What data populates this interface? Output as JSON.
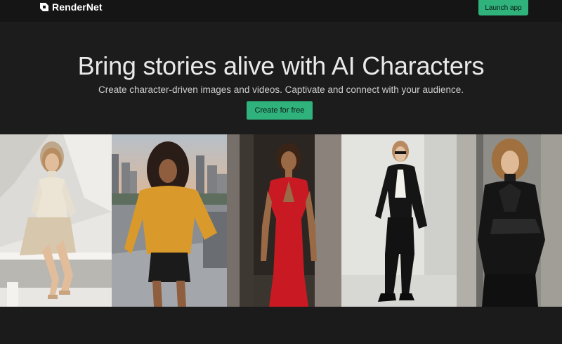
{
  "header": {
    "brand_name": "RenderNet",
    "logo_icon": "rendernet-logo-icon",
    "launch_label": "Launch app"
  },
  "hero": {
    "headline": "Bring stories alive with AI Characters",
    "subheadline": "Create character-driven images and videos. Captivate and connect with your audience.",
    "cta_label": "Create for free"
  },
  "gallery": {
    "images": [
      {
        "subject": "woman-cream-knit-outfit-seated"
      },
      {
        "subject": "woman-mustard-sweater-city"
      },
      {
        "subject": "woman-red-dress-doorway"
      },
      {
        "subject": "woman-black-suit-studio"
      },
      {
        "subject": "woman-black-leather-jacket-wall"
      }
    ]
  },
  "colors": {
    "accent": "#2fb27c",
    "page_bg": "#1c1c1c",
    "topbar_bg": "#151515",
    "headline_text": "#e9e9e9"
  }
}
